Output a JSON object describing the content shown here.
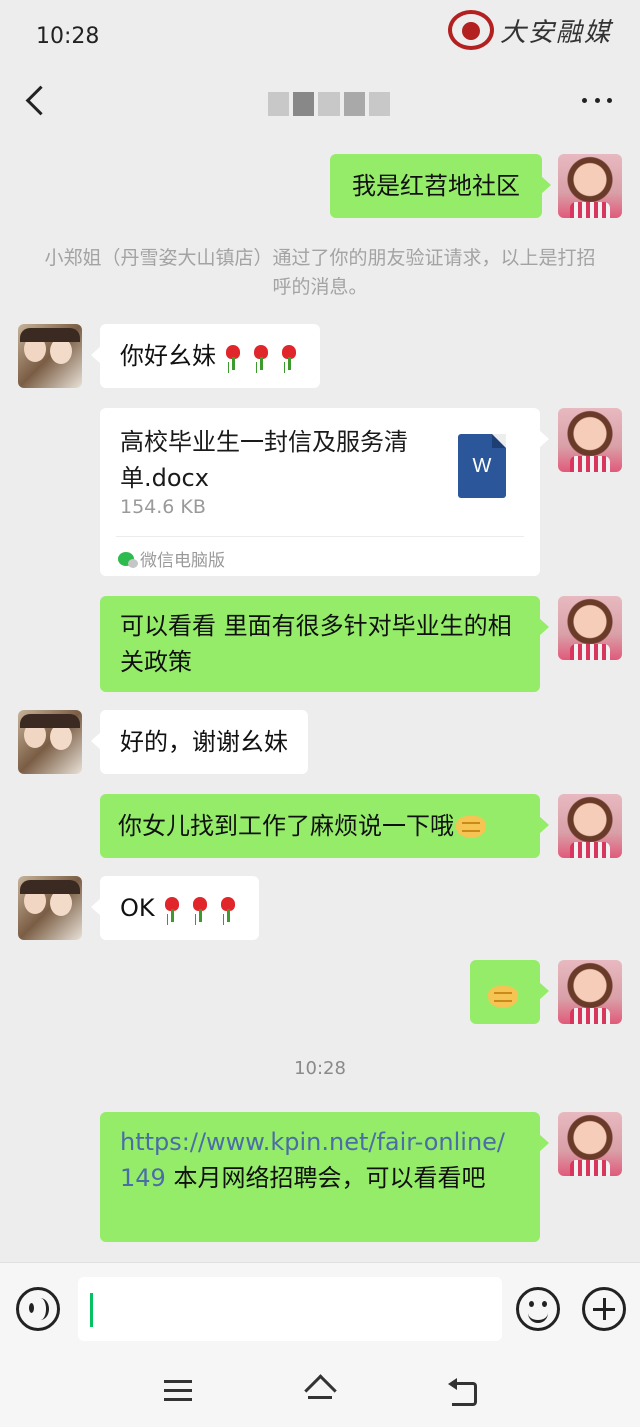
{
  "status_bar": {
    "time": "10:28",
    "watermark_text": "大安融媒"
  },
  "header": {
    "title_redacted": true
  },
  "messages": {
    "m1": {
      "sender": "me",
      "text": "我是红苕地社区"
    },
    "system_notice": "小郑姐（丹雪姿大山镇店）通过了你的朋友验证请求，以上是打招呼的消息。",
    "m2": {
      "sender": "them",
      "text": "你好幺妹",
      "emoji": "rose"
    },
    "file": {
      "sender": "me",
      "name": "高校毕业生一封信及服务清单.docx",
      "size": "154.6 KB",
      "source": "微信电脑版",
      "icon_label": "W"
    },
    "m3": {
      "sender": "me",
      "text": "可以看看  里面有很多针对毕业生的相关政策"
    },
    "m4": {
      "sender": "them",
      "text": "好的，谢谢幺妹"
    },
    "m5": {
      "sender": "me",
      "text": "你女儿找到工作了麻烦说一下哦",
      "emoji": "handshake"
    },
    "m6": {
      "sender": "them",
      "text": "OK",
      "emoji": "rose"
    },
    "m7": {
      "sender": "me",
      "emoji": "handshake"
    },
    "time_divider": "10:28",
    "m8": {
      "sender": "me",
      "link": "https://www.kpin.net/fair-online/149",
      "text": " 本月网络招聘会，可以看看吧"
    }
  },
  "input_bar": {
    "value": ""
  },
  "colors": {
    "my_bubble": "#95ec69",
    "their_bubble": "#ffffff",
    "background": "#ededed",
    "link": "#4a6da7",
    "caret": "#07c160",
    "word_icon": "#2b579a"
  },
  "icons": [
    "back-icon",
    "more-icon",
    "voice-icon",
    "emoji-icon",
    "plus-icon",
    "menu-icon",
    "home-icon",
    "return-icon",
    "word-file-icon",
    "wechat-mini-icon",
    "rose-emoji",
    "handshake-emoji"
  ]
}
